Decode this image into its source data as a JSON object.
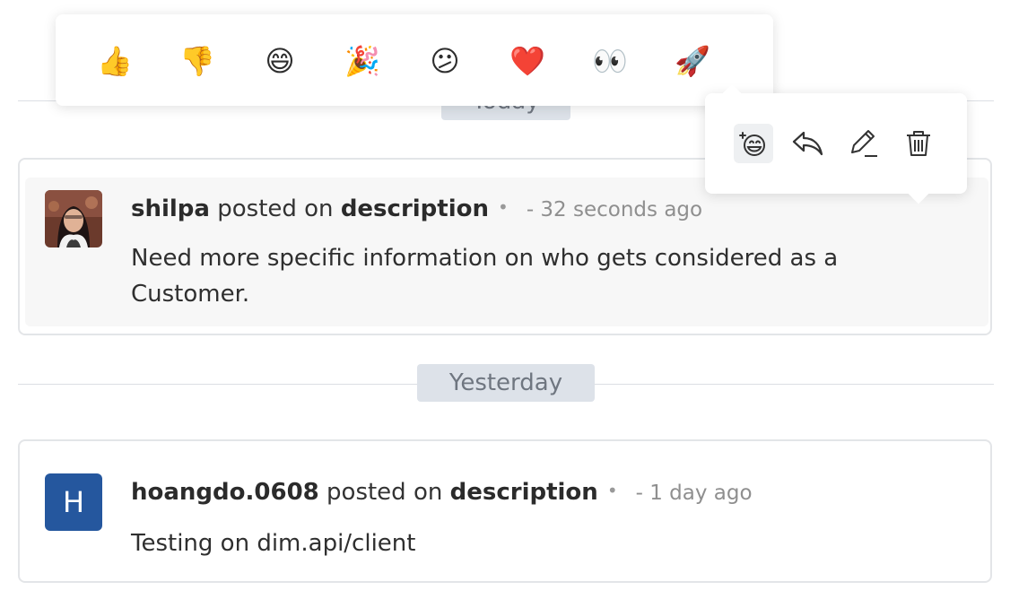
{
  "dividers": {
    "today": "Today",
    "yesterday": "Yesterday"
  },
  "reactions": {
    "emojis": [
      {
        "icon": "thumbs-up",
        "glyph": "👍"
      },
      {
        "icon": "thumbs-down",
        "glyph": "👎"
      },
      {
        "icon": "grinning-face",
        "glyph": "😄"
      },
      {
        "icon": "party-popper",
        "glyph": "🎉"
      },
      {
        "icon": "confused-face",
        "glyph": "😕"
      },
      {
        "icon": "red-heart",
        "glyph": "❤️"
      },
      {
        "icon": "eyes",
        "glyph": "👀"
      },
      {
        "icon": "rocket",
        "glyph": "🚀"
      }
    ]
  },
  "actions": [
    "add-reaction",
    "reply",
    "edit",
    "delete"
  ],
  "comments": [
    {
      "author": "shilpa",
      "action_text": "posted on",
      "target": "description",
      "separator": "•",
      "time": "- 32 seconds ago",
      "body": "Need more specific information on who gets considered as a Customer.",
      "avatar": "photo"
    },
    {
      "author": "hoangdo.0608",
      "action_text": "posted on",
      "target": "description",
      "separator": "•",
      "time": "- 1 day ago",
      "body": "Testing on dim.api/client",
      "avatar_letter": "H",
      "avatar_color": "#25579e"
    }
  ]
}
